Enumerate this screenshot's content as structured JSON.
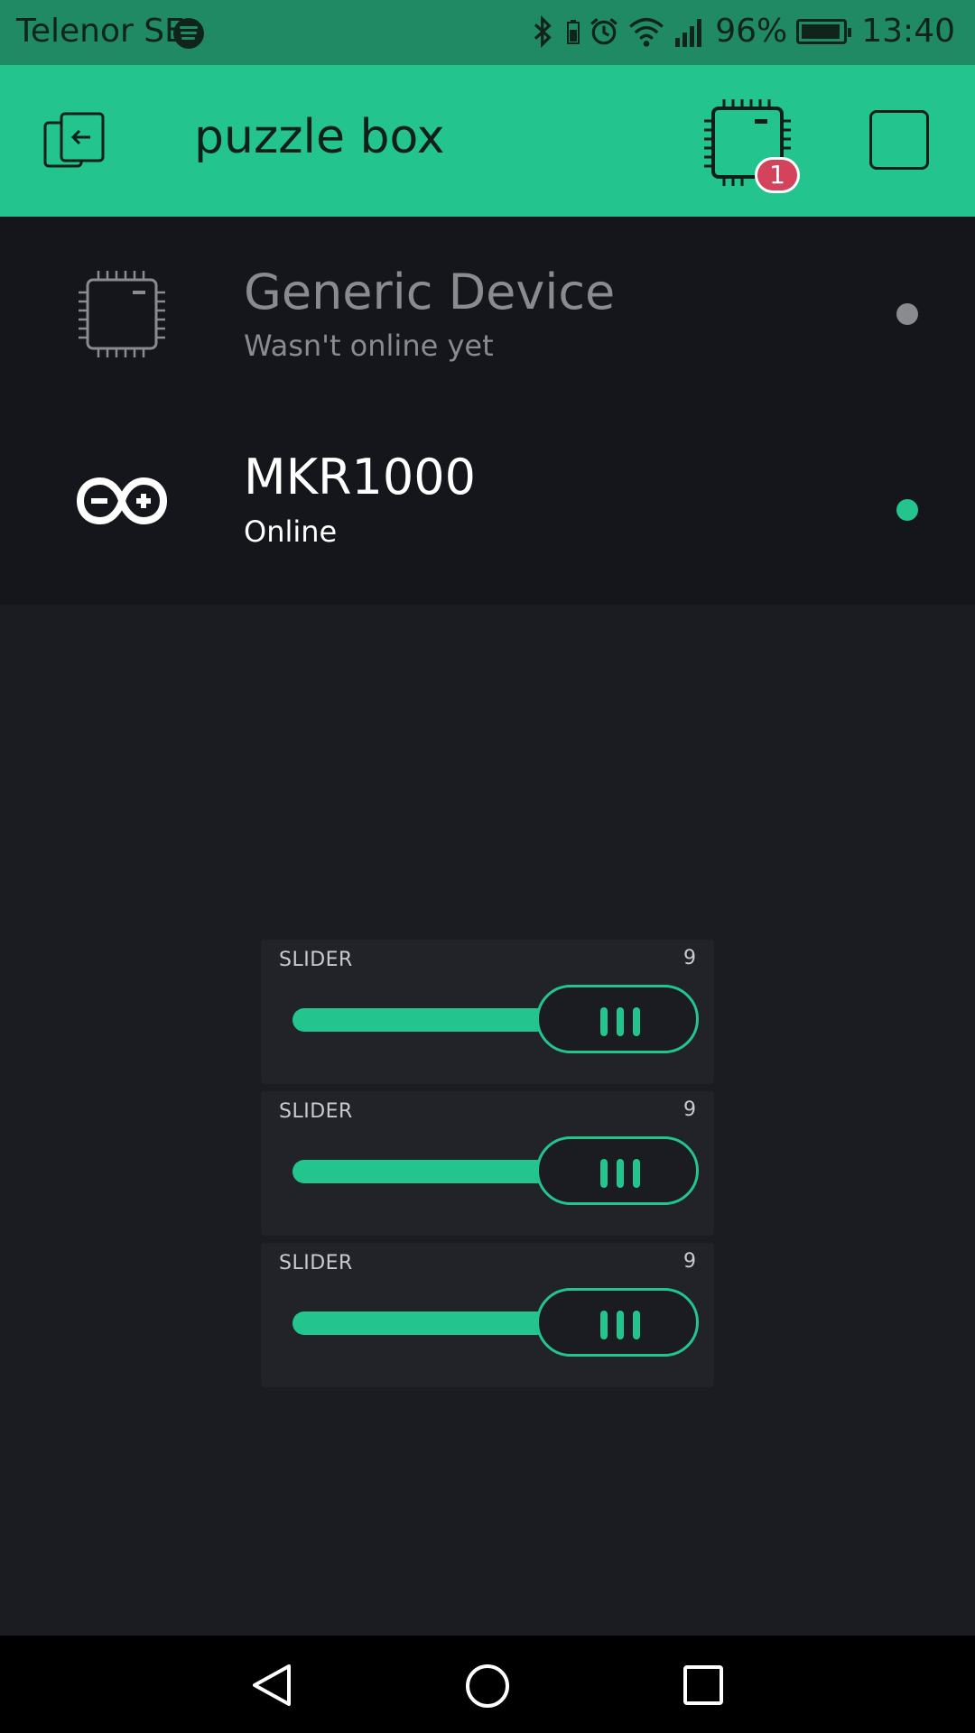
{
  "status_bar": {
    "carrier": "Telenor SE",
    "battery_percent": "96%",
    "battery_level": 0.96,
    "time": "13:40"
  },
  "app_bar": {
    "title": "puzzle box",
    "notification_count": "1"
  },
  "devices": [
    {
      "name": "Generic Device",
      "status": "Wasn't online yet",
      "icon": "chip-icon",
      "online": false,
      "dot_color": "#8a8b8f"
    },
    {
      "name": "MKR1000",
      "status": "Online",
      "icon": "arduino-icon",
      "online": true,
      "dot_color": "#23c48e"
    }
  ],
  "sliders": [
    {
      "label": "SLIDER",
      "value": "9",
      "level": 0.9
    },
    {
      "label": "SLIDER",
      "value": "9",
      "level": 0.9
    },
    {
      "label": "SLIDER",
      "value": "9",
      "level": 0.9
    }
  ],
  "colors": {
    "accent": "#23c48e",
    "status_bar": "#1f8a64",
    "background": "#1b1c21",
    "device_panel": "#15161b",
    "badge": "#d3435c"
  }
}
